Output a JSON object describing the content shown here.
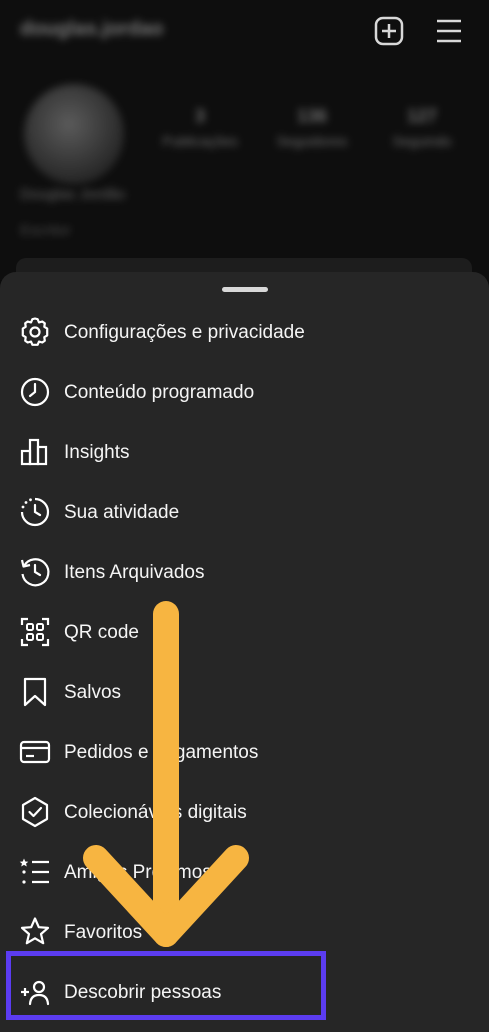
{
  "profile": {
    "username": "douglas.jordao",
    "stats": [
      {
        "value": "3",
        "label": "Publicações"
      },
      {
        "value": "136",
        "label": "Seguidores"
      },
      {
        "value": "127",
        "label": "Seguindo"
      }
    ],
    "display_name": "Douglas Jordão",
    "bio": "Escritor"
  },
  "menu": {
    "items": [
      {
        "label": "Configurações e privacidade",
        "icon": "gear-icon"
      },
      {
        "label": "Conteúdo programado",
        "icon": "clock-icon"
      },
      {
        "label": "Insights",
        "icon": "bar-chart-icon"
      },
      {
        "label": "Sua atividade",
        "icon": "activity-icon"
      },
      {
        "label": "Itens Arquivados",
        "icon": "archive-history-icon"
      },
      {
        "label": "QR code",
        "icon": "qr-code-icon"
      },
      {
        "label": "Salvos",
        "icon": "bookmark-icon"
      },
      {
        "label": "Pedidos e pagamentos",
        "icon": "credit-card-icon"
      },
      {
        "label": "Colecionáveis digitais",
        "icon": "badge-check-icon"
      },
      {
        "label": "Amigos Próximos",
        "icon": "close-friends-list-icon"
      },
      {
        "label": "Favoritos",
        "icon": "star-icon"
      },
      {
        "label": "Descobrir pessoas",
        "icon": "add-person-icon"
      }
    ]
  },
  "colors": {
    "sheet": "#262626",
    "highlight": "#5b3cf0",
    "arrow": "#f7b541"
  }
}
